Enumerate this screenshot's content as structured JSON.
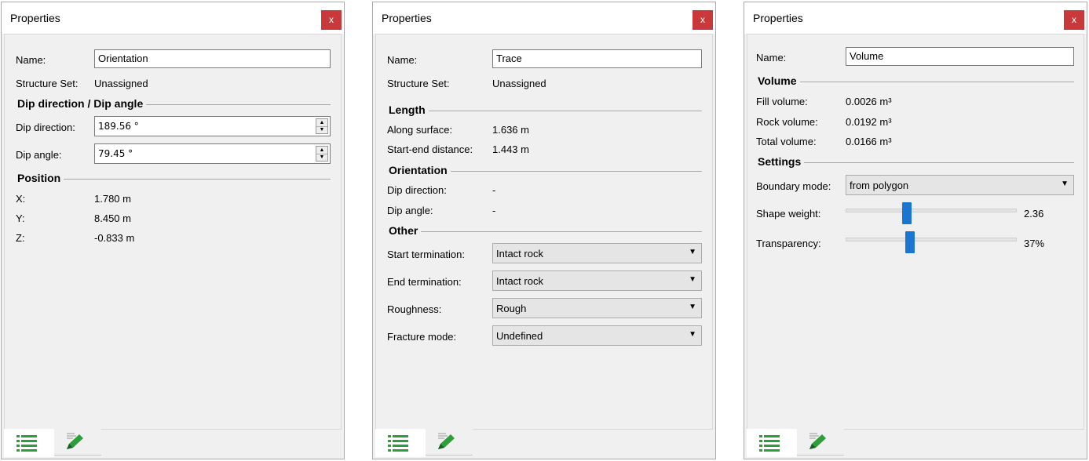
{
  "panels": [
    {
      "title": "Properties",
      "close_label": "x",
      "name_label": "Name:",
      "name_value": "Orientation",
      "structure_set_label": "Structure Set:",
      "structure_set_value": "Unassigned",
      "section_dip": "Dip direction / Dip angle",
      "dip_direction_label": "Dip direction:",
      "dip_direction_value": "189.56 °",
      "dip_angle_label": "Dip angle:",
      "dip_angle_value": "79.45 °",
      "section_position": "Position",
      "x_label": "X:",
      "x_value": "1.780 m",
      "y_label": "Y:",
      "y_value": "8.450 m",
      "z_label": "Z:",
      "z_value": "-0.833 m"
    },
    {
      "title": "Properties",
      "close_label": "x",
      "name_label": "Name:",
      "name_value": "Trace",
      "structure_set_label": "Structure Set:",
      "structure_set_value": "Unassigned",
      "section_length": "Length",
      "along_surface_label": "Along surface:",
      "along_surface_value": "1.636 m",
      "start_end_label": "Start-end distance:",
      "start_end_value": "1.443 m",
      "section_orientation": "Orientation",
      "dip_direction_label": "Dip direction:",
      "dip_direction_value": "-",
      "dip_angle_label": "Dip angle:",
      "dip_angle_value": "-",
      "section_other": "Other",
      "start_termination_label": "Start termination:",
      "start_termination_value": "Intact rock",
      "end_termination_label": "End termination:",
      "end_termination_value": "Intact rock",
      "roughness_label": "Roughness:",
      "roughness_value": "Rough",
      "fracture_mode_label": "Fracture mode:",
      "fracture_mode_value": "Undefined"
    },
    {
      "title": "Properties",
      "close_label": "x",
      "name_label": "Name:",
      "name_value": "Volume",
      "section_volume": "Volume",
      "fill_volume_label": "Fill volume:",
      "fill_volume_value": "0.0026 m³",
      "rock_volume_label": "Rock volume:",
      "rock_volume_value": "0.0192 m³",
      "total_volume_label": "Total volume:",
      "total_volume_value": "0.0166 m³",
      "section_settings": "Settings",
      "boundary_mode_label": "Boundary mode:",
      "boundary_mode_value": "from polygon",
      "shape_weight_label": "Shape weight:",
      "shape_weight_value": "2.36",
      "shape_weight_fraction": 0.35,
      "transparency_label": "Transparency:",
      "transparency_value": "37%",
      "transparency_fraction": 0.37
    }
  ],
  "icons": {
    "properties_tab": "list-icon",
    "edit_tab": "pencil-icon"
  },
  "colors": {
    "close_button": "#c9393b",
    "slider_thumb": "#1a76d2",
    "tab_icon_green": "#2e9e3a"
  }
}
